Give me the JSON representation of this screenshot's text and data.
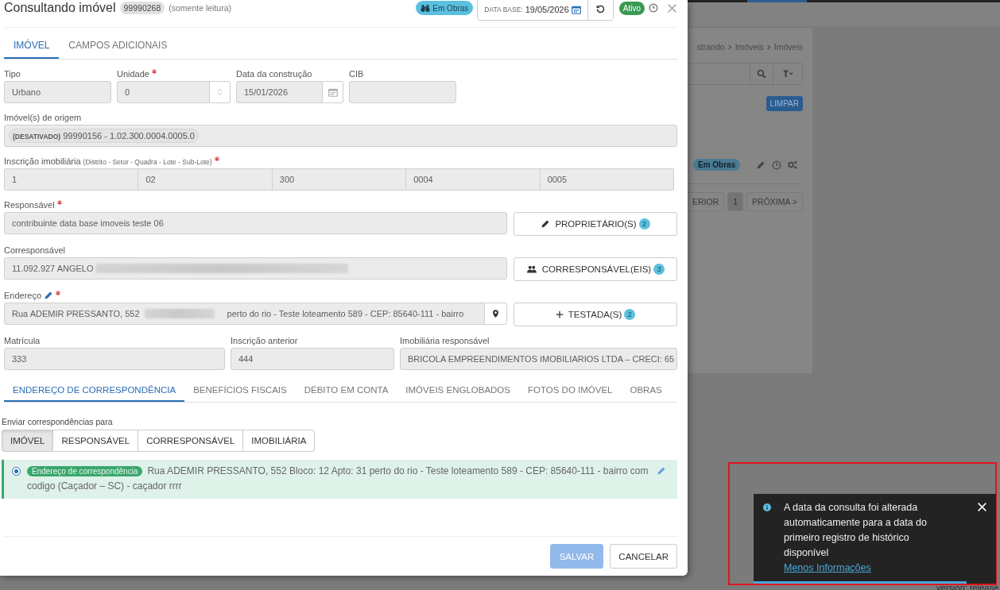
{
  "background_page": {
    "breadcrumb": [
      "strando",
      "Imóveis",
      "Imóveis"
    ],
    "clear_button": "LIMPAR",
    "row_tag": "Em Obras",
    "pagination": [
      {
        "label": "ERIOR",
        "selected": false
      },
      {
        "label": "1",
        "selected": true
      },
      {
        "label": "PRÓXIMA >",
        "selected": false
      }
    ],
    "version": "version: release"
  },
  "dialog": {
    "title": "Consultando imóvel",
    "code": "99990268",
    "mode": "(somente leitura)",
    "works_tag": "Em Obras",
    "date_base": {
      "label": "DATA BASE:",
      "value": "19/05/2026"
    },
    "status_tag": "Ativo",
    "tabs": [
      {
        "label": "IMÓVEL",
        "selected": true
      },
      {
        "label": "CAMPOS ADICIONAIS",
        "selected": false
      }
    ],
    "tipo": {
      "label": "Tipo",
      "value": "Urbano"
    },
    "unidade": {
      "label": "Unidade",
      "required": true,
      "value": "0"
    },
    "construction_date": {
      "label": "Data da construção",
      "value": "15/01/2026"
    },
    "cib": {
      "label": "CIB"
    },
    "origin": {
      "label": "Imóvel(s) de origem",
      "chip": "**(DESATIVADO)** 99990156 - 1.02.300.0004.0005.0"
    },
    "registration": {
      "label": "Inscrição imobiliária",
      "hint": "(Distrito - Setor - Quadra - Lote - Sub-Lote)",
      "required": true,
      "parts": [
        "1",
        "02",
        "300",
        "0004",
        "0005"
      ]
    },
    "responsible": {
      "label": "Responsável",
      "required": true,
      "value": "contribuinte data base imoveis teste 06",
      "button": "PROPRIETÁRIO(S)",
      "count": "2"
    },
    "co_responsible": {
      "label": "Corresponsável",
      "value": "11.092.927 ANGELO",
      "button": "CORRESPONSÁVEL(EIS)",
      "count": "3"
    },
    "address": {
      "label": "Endereço",
      "required": true,
      "value_start": "Rua ADEMIR PRESSANTO, 552",
      "value_end": "perto do rio - Teste loteamento 589 - CEP: 85640-111 - bairro",
      "button": "TESTADA(S)",
      "count": "2"
    },
    "matricula": {
      "label": "Matrícula",
      "value": "333"
    },
    "previous_registration": {
      "label": "Inscrição anterior",
      "value": "444"
    },
    "agency": {
      "label": "Imobiliária responsável",
      "value": "BRICOLA EMPREENDIMENTOS IMOBILIARIOS LTDA – CRECI: 65"
    },
    "sub_tabs": [
      {
        "label": "ENDEREÇO DE CORRESPONDÊNCIA",
        "selected": true
      },
      {
        "label": "BENEFÍCIOS FISCAIS",
        "selected": false
      },
      {
        "label": "DÉBITO EM CONTA",
        "selected": false
      },
      {
        "label": "IMÓVEIS ENGLOBADOS",
        "selected": false
      },
      {
        "label": "FOTOS DO IMÓVEL",
        "selected": false
      },
      {
        "label": "OBRAS",
        "selected": false
      }
    ],
    "send_to": {
      "label": "Enviar correspondências para",
      "options": [
        {
          "label": "IMÓVEL",
          "selected": true
        },
        {
          "label": "RESPONSÁVEL",
          "selected": false
        },
        {
          "label": "CORRESPONSÁVEL",
          "selected": false
        },
        {
          "label": "IMOBILIÁRIA",
          "selected": false
        }
      ]
    },
    "correspondence": {
      "selected": true,
      "tag": "Endereço de correspondência",
      "address": "Rua ADEMIR PRESSANTO, 552 Bloco: 12 Apto: 31 perto do rio - Teste loteamento 589 - CEP: 85640-111 - bairro com codigo (Caçador – SC) - caçador rrrr"
    },
    "save_button": {
      "label": "SALVAR",
      "disabled": true
    },
    "cancel_button": {
      "label": "CANCELAR"
    }
  },
  "toast": {
    "message": "A data da consulta foi alterada automaticamente para a data do primeiro registro de histórico disponível",
    "link": "Menos Informações",
    "level": 0.88
  }
}
